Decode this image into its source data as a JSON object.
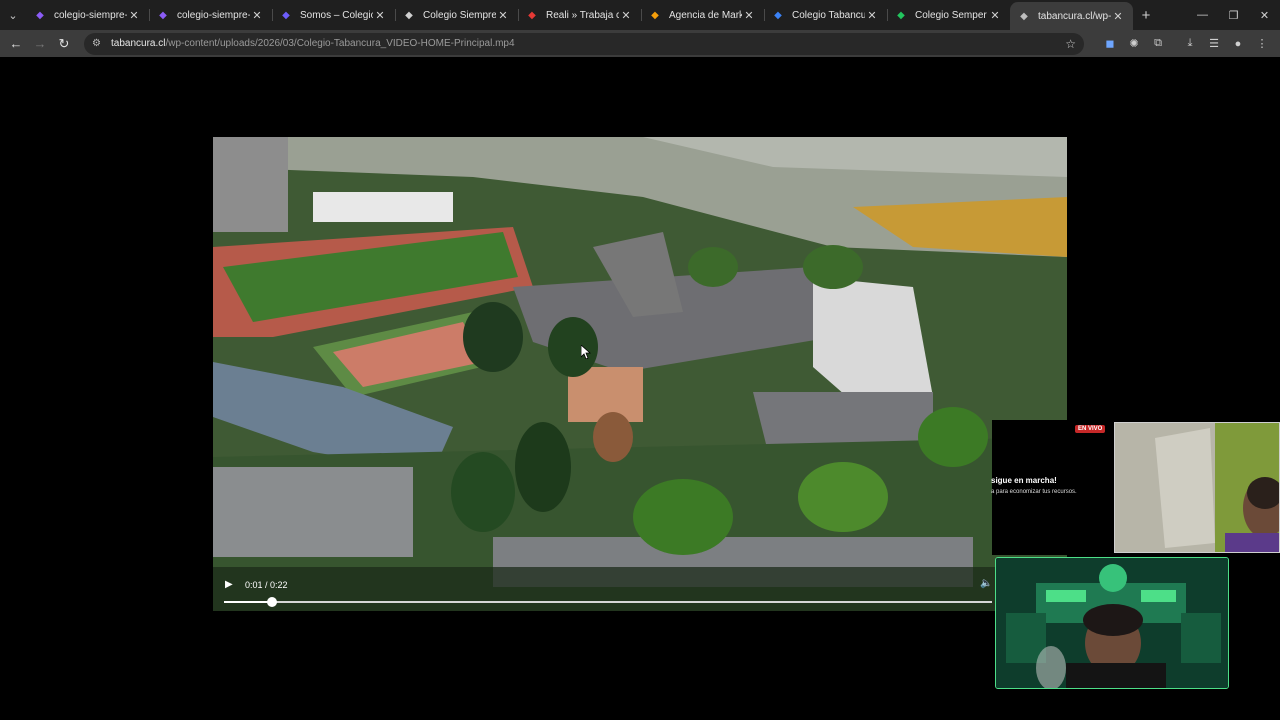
{
  "tabs": [
    {
      "title": "colegio-siempre-alto",
      "favicon": "stripe-icon",
      "fav_color": "#8b5cf6",
      "active": false
    },
    {
      "title": "colegio-siempre-alto",
      "favicon": "stripe-icon",
      "fav_color": "#8b5cf6",
      "active": false
    },
    {
      "title": "Somos – Colegio Sen",
      "favicon": "colegio-crest-icon",
      "fav_color": "#6d5dfc",
      "active": false
    },
    {
      "title": "Colegio Siempre Alto",
      "favicon": "school-icon",
      "fav_color": "#cfcfcf",
      "active": false
    },
    {
      "title": "Reali » Trabaja con N",
      "favicon": "reali-icon",
      "fav_color": "#e53935",
      "active": false
    },
    {
      "title": "Agencia de Marketin",
      "favicon": "agency-icon",
      "fav_color": "#f59e0b",
      "active": false
    },
    {
      "title": "Colegio Tabancura –",
      "favicon": "tabancura-icon",
      "fav_color": "#3b82f6",
      "active": false
    },
    {
      "title": "Colegio Semper Altiu",
      "favicon": "map-pin-icon",
      "fav_color": "#22c55e",
      "active": false
    },
    {
      "title": "tabancura.cl/wp-cont",
      "favicon": "globe-icon",
      "fav_color": "#bdbdbd",
      "active": true
    }
  ],
  "tab_close_glyph": "✕",
  "new_tab_glyph": "+",
  "window": {
    "minimize": "—",
    "restore": "❐",
    "close": "✕"
  },
  "address": {
    "host": "tabancura.cl",
    "path": "/wp-content/uploads/2026/03/Colegio-Tabancura_VIDEO-HOME-Principal.mp4"
  },
  "video": {
    "current_time": "0:01",
    "duration": "0:22",
    "time_display": "0:01 / 0:22",
    "progress_fraction": 0.062
  },
  "overlay": {
    "live_badge": "EN VIVO",
    "title": "sigue en marcha!",
    "subtitle": "a para economizar tus recursos."
  },
  "colors": {
    "tabstrip_bg": "#1f1f1f",
    "toolbar_bg": "#3c3c3c",
    "live_red": "#c62828",
    "cam_border_green": "#4ddf88"
  }
}
